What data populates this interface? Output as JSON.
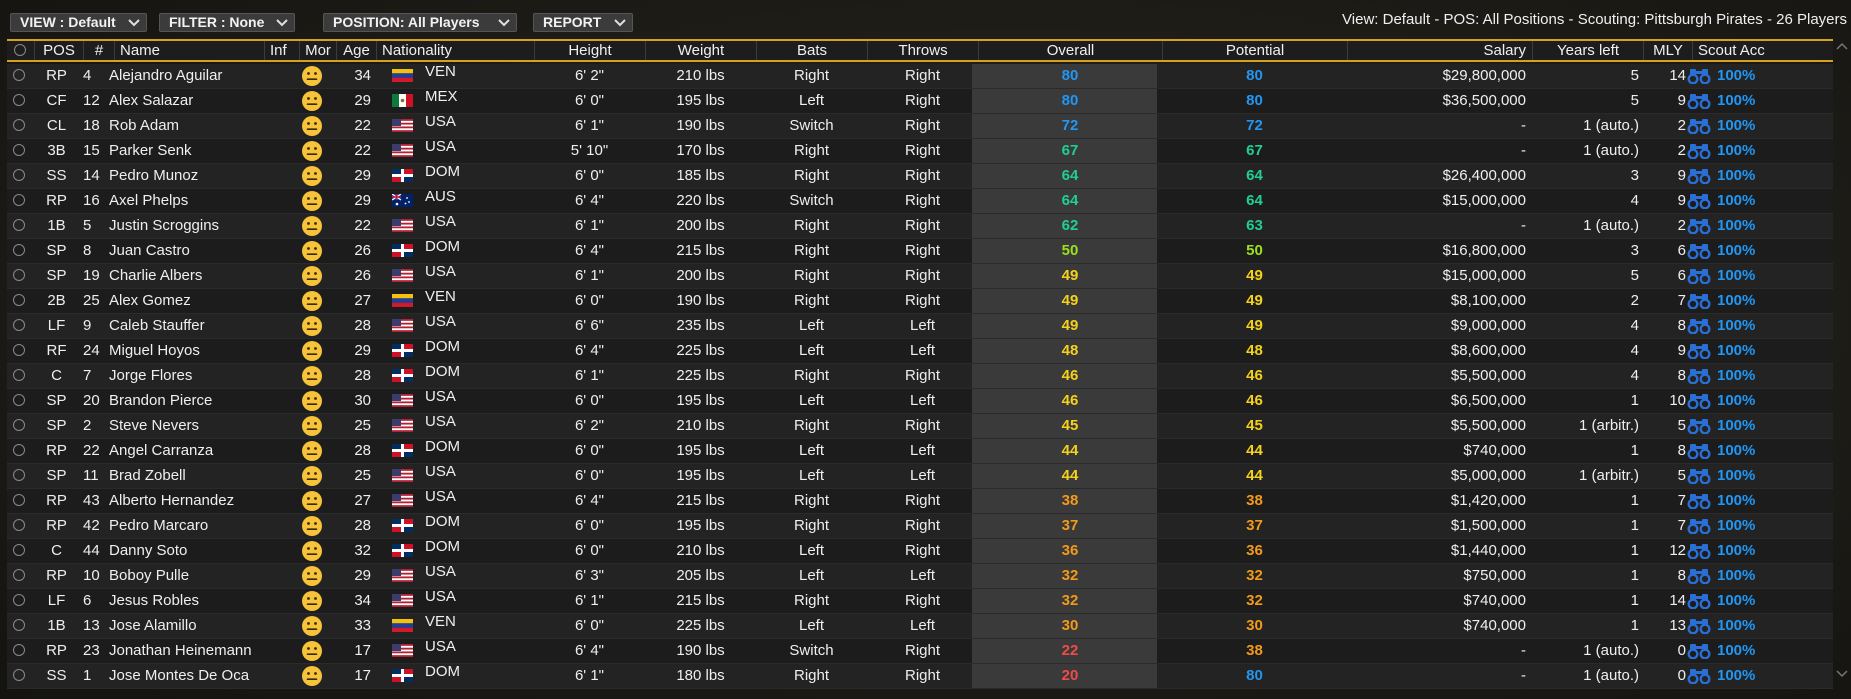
{
  "toolbar": {
    "view_label": "VIEW : Default",
    "filter_label": "FILTER : None",
    "position_label": "POSITION: All Players",
    "report_label": "REPORT"
  },
  "summary": "View: Default - POS: All Positions - Scouting: Pittsburgh Pirates - 26 Players",
  "columns": [
    "POS",
    "#",
    "Name",
    "Inf",
    "Mor",
    "Age",
    "Nationality",
    "Height",
    "Weight",
    "Bats",
    "Throws",
    "Overall",
    "Potential",
    "Salary",
    "Years left",
    "MLY",
    "Scout Acc"
  ],
  "rating_colors": {
    "blue": "#2196f3",
    "teal": "#1fcf94",
    "lime": "#9be01e",
    "yellow": "#f5d21a",
    "orange": "#f29a1a",
    "red": "#ef4b4b"
  },
  "accent_color": "#d6a21c",
  "players": [
    {
      "pos": "RP",
      "num": "4",
      "name": "Alejandro Aguilar",
      "age": "34",
      "nat": "VEN",
      "height": "6' 2\"",
      "weight": "210 lbs",
      "bats": "Right",
      "throws": "Right",
      "overall": "80",
      "potential": "80",
      "salary": "$29,800,000",
      "years": "5",
      "mly": "14",
      "acc": "100%"
    },
    {
      "pos": "CF",
      "num": "12",
      "name": "Alex Salazar",
      "age": "29",
      "nat": "MEX",
      "height": "6' 0\"",
      "weight": "195 lbs",
      "bats": "Left",
      "throws": "Right",
      "overall": "80",
      "potential": "80",
      "salary": "$36,500,000",
      "years": "5",
      "mly": "9",
      "acc": "100%"
    },
    {
      "pos": "CL",
      "num": "18",
      "name": "Rob Adam",
      "age": "22",
      "nat": "USA",
      "height": "6' 1\"",
      "weight": "190 lbs",
      "bats": "Switch",
      "throws": "Right",
      "overall": "72",
      "potential": "72",
      "salary": "-",
      "years": "1 (auto.)",
      "mly": "2",
      "acc": "100%"
    },
    {
      "pos": "3B",
      "num": "15",
      "name": "Parker Senk",
      "age": "22",
      "nat": "USA",
      "height": "5' 10\"",
      "weight": "170 lbs",
      "bats": "Right",
      "throws": "Right",
      "overall": "67",
      "potential": "67",
      "salary": "-",
      "years": "1 (auto.)",
      "mly": "2",
      "acc": "100%"
    },
    {
      "pos": "SS",
      "num": "14",
      "name": "Pedro Munoz",
      "age": "29",
      "nat": "DOM",
      "height": "6' 0\"",
      "weight": "185 lbs",
      "bats": "Right",
      "throws": "Right",
      "overall": "64",
      "potential": "64",
      "salary": "$26,400,000",
      "years": "3",
      "mly": "9",
      "acc": "100%"
    },
    {
      "pos": "RP",
      "num": "16",
      "name": "Axel Phelps",
      "age": "29",
      "nat": "AUS",
      "height": "6' 4\"",
      "weight": "220 lbs",
      "bats": "Switch",
      "throws": "Right",
      "overall": "64",
      "potential": "64",
      "salary": "$15,000,000",
      "years": "4",
      "mly": "9",
      "acc": "100%"
    },
    {
      "pos": "1B",
      "num": "5",
      "name": "Justin Scroggins",
      "age": "22",
      "nat": "USA",
      "height": "6' 1\"",
      "weight": "200 lbs",
      "bats": "Right",
      "throws": "Right",
      "overall": "62",
      "potential": "63",
      "salary": "-",
      "years": "1 (auto.)",
      "mly": "2",
      "acc": "100%"
    },
    {
      "pos": "SP",
      "num": "8",
      "name": "Juan Castro",
      "age": "26",
      "nat": "DOM",
      "height": "6' 4\"",
      "weight": "215 lbs",
      "bats": "Right",
      "throws": "Right",
      "overall": "50",
      "potential": "50",
      "salary": "$16,800,000",
      "years": "3",
      "mly": "6",
      "acc": "100%"
    },
    {
      "pos": "SP",
      "num": "19",
      "name": "Charlie Albers",
      "age": "26",
      "nat": "USA",
      "height": "6' 1\"",
      "weight": "200 lbs",
      "bats": "Right",
      "throws": "Right",
      "overall": "49",
      "potential": "49",
      "salary": "$15,000,000",
      "years": "5",
      "mly": "6",
      "acc": "100%"
    },
    {
      "pos": "2B",
      "num": "25",
      "name": "Alex Gomez",
      "age": "27",
      "nat": "VEN",
      "height": "6' 0\"",
      "weight": "190 lbs",
      "bats": "Right",
      "throws": "Right",
      "overall": "49",
      "potential": "49",
      "salary": "$8,100,000",
      "years": "2",
      "mly": "7",
      "acc": "100%"
    },
    {
      "pos": "LF",
      "num": "9",
      "name": "Caleb Stauffer",
      "age": "28",
      "nat": "USA",
      "height": "6' 6\"",
      "weight": "235 lbs",
      "bats": "Left",
      "throws": "Left",
      "overall": "49",
      "potential": "49",
      "salary": "$9,000,000",
      "years": "4",
      "mly": "8",
      "acc": "100%"
    },
    {
      "pos": "RF",
      "num": "24",
      "name": "Miguel Hoyos",
      "age": "29",
      "nat": "DOM",
      "height": "6' 4\"",
      "weight": "225 lbs",
      "bats": "Left",
      "throws": "Left",
      "overall": "48",
      "potential": "48",
      "salary": "$8,600,000",
      "years": "4",
      "mly": "9",
      "acc": "100%"
    },
    {
      "pos": "C",
      "num": "7",
      "name": "Jorge Flores",
      "age": "28",
      "nat": "DOM",
      "height": "6' 1\"",
      "weight": "225 lbs",
      "bats": "Right",
      "throws": "Right",
      "overall": "46",
      "potential": "46",
      "salary": "$5,500,000",
      "years": "4",
      "mly": "8",
      "acc": "100%"
    },
    {
      "pos": "SP",
      "num": "20",
      "name": "Brandon Pierce",
      "age": "30",
      "nat": "USA",
      "height": "6' 0\"",
      "weight": "195 lbs",
      "bats": "Left",
      "throws": "Left",
      "overall": "46",
      "potential": "46",
      "salary": "$6,500,000",
      "years": "1",
      "mly": "10",
      "acc": "100%"
    },
    {
      "pos": "SP",
      "num": "2",
      "name": "Steve Nevers",
      "age": "25",
      "nat": "USA",
      "height": "6' 2\"",
      "weight": "210 lbs",
      "bats": "Right",
      "throws": "Right",
      "overall": "45",
      "potential": "45",
      "salary": "$5,500,000",
      "years": "1 (arbitr.)",
      "mly": "5",
      "acc": "100%"
    },
    {
      "pos": "RP",
      "num": "22",
      "name": "Angel Carranza",
      "age": "28",
      "nat": "DOM",
      "height": "6' 0\"",
      "weight": "195 lbs",
      "bats": "Left",
      "throws": "Left",
      "overall": "44",
      "potential": "44",
      "salary": "$740,000",
      "years": "1",
      "mly": "8",
      "acc": "100%"
    },
    {
      "pos": "SP",
      "num": "11",
      "name": "Brad Zobell",
      "age": "25",
      "nat": "USA",
      "height": "6' 0\"",
      "weight": "195 lbs",
      "bats": "Left",
      "throws": "Left",
      "overall": "44",
      "potential": "44",
      "salary": "$5,000,000",
      "years": "1 (arbitr.)",
      "mly": "5",
      "acc": "100%"
    },
    {
      "pos": "RP",
      "num": "43",
      "name": "Alberto Hernandez",
      "age": "27",
      "nat": "USA",
      "height": "6' 4\"",
      "weight": "215 lbs",
      "bats": "Right",
      "throws": "Right",
      "overall": "38",
      "potential": "38",
      "salary": "$1,420,000",
      "years": "1",
      "mly": "7",
      "acc": "100%"
    },
    {
      "pos": "RP",
      "num": "42",
      "name": "Pedro Marcaro",
      "age": "28",
      "nat": "DOM",
      "height": "6' 0\"",
      "weight": "195 lbs",
      "bats": "Right",
      "throws": "Right",
      "overall": "37",
      "potential": "37",
      "salary": "$1,500,000",
      "years": "1",
      "mly": "7",
      "acc": "100%"
    },
    {
      "pos": "C",
      "num": "44",
      "name": "Danny Soto",
      "age": "32",
      "nat": "DOM",
      "height": "6' 0\"",
      "weight": "210 lbs",
      "bats": "Left",
      "throws": "Right",
      "overall": "36",
      "potential": "36",
      "salary": "$1,440,000",
      "years": "1",
      "mly": "12",
      "acc": "100%"
    },
    {
      "pos": "RP",
      "num": "10",
      "name": "Boboy Pulle",
      "age": "29",
      "nat": "USA",
      "height": "6' 3\"",
      "weight": "205 lbs",
      "bats": "Left",
      "throws": "Left",
      "overall": "32",
      "potential": "32",
      "salary": "$750,000",
      "years": "1",
      "mly": "8",
      "acc": "100%"
    },
    {
      "pos": "LF",
      "num": "6",
      "name": "Jesus Robles",
      "age": "34",
      "nat": "USA",
      "height": "6' 1\"",
      "weight": "215 lbs",
      "bats": "Right",
      "throws": "Right",
      "overall": "32",
      "potential": "32",
      "salary": "$740,000",
      "years": "1",
      "mly": "14",
      "acc": "100%"
    },
    {
      "pos": "1B",
      "num": "13",
      "name": "Jose Alamillo",
      "age": "33",
      "nat": "VEN",
      "height": "6' 0\"",
      "weight": "225 lbs",
      "bats": "Left",
      "throws": "Left",
      "overall": "30",
      "potential": "30",
      "salary": "$740,000",
      "years": "1",
      "mly": "13",
      "acc": "100%"
    },
    {
      "pos": "RP",
      "num": "23",
      "name": "Jonathan Heinemann",
      "age": "17",
      "nat": "USA",
      "height": "6' 4\"",
      "weight": "190 lbs",
      "bats": "Switch",
      "throws": "Right",
      "overall": "22",
      "potential": "38",
      "salary": "-",
      "years": "1 (auto.)",
      "mly": "0",
      "acc": "100%"
    },
    {
      "pos": "SS",
      "num": "1",
      "name": "Jose Montes De Oca",
      "age": "17",
      "nat": "DOM",
      "height": "6' 1\"",
      "weight": "180 lbs",
      "bats": "Right",
      "throws": "Right",
      "overall": "20",
      "potential": "80",
      "salary": "-",
      "years": "1 (auto.)",
      "mly": "0",
      "acc": "100%"
    }
  ]
}
